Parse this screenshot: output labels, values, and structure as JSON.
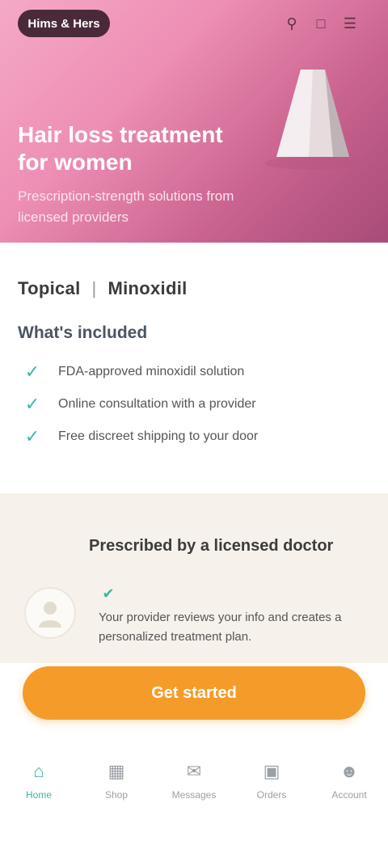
{
  "header": {
    "brand": "Hims & Hers",
    "icons": [
      "search-icon",
      "bag-icon",
      "menu-icon"
    ]
  },
  "hero": {
    "title": "Hair loss treatment for women",
    "subtitle": "Prescription-strength solutions from licensed providers"
  },
  "product": {
    "meta": [
      "Topical",
      "|",
      "Minoxidil"
    ],
    "section_title": "What's included",
    "benefits": [
      "FDA-approved minoxidil solution",
      "Online consultation with a provider",
      "Free discreet shipping to your door"
    ]
  },
  "doctor": {
    "title": "Prescribed by a licensed doctor",
    "badge_icon": "shield-check-icon",
    "description": "Your provider reviews your info and creates a personalized treatment plan."
  },
  "cta": {
    "label": "Get started"
  },
  "bottom_nav": {
    "items": [
      {
        "label": "Home",
        "icon": "home-icon",
        "active": true
      },
      {
        "label": "Shop",
        "icon": "shop-icon",
        "active": false
      },
      {
        "label": "Messages",
        "icon": "message-icon",
        "active": false
      },
      {
        "label": "Orders",
        "icon": "box-icon",
        "active": false
      },
      {
        "label": "Account",
        "icon": "user-icon",
        "active": false
      }
    ]
  },
  "colors": {
    "accent": "#39b8a8",
    "cta": "#f59b2a",
    "hero": "#ee8fb5"
  }
}
